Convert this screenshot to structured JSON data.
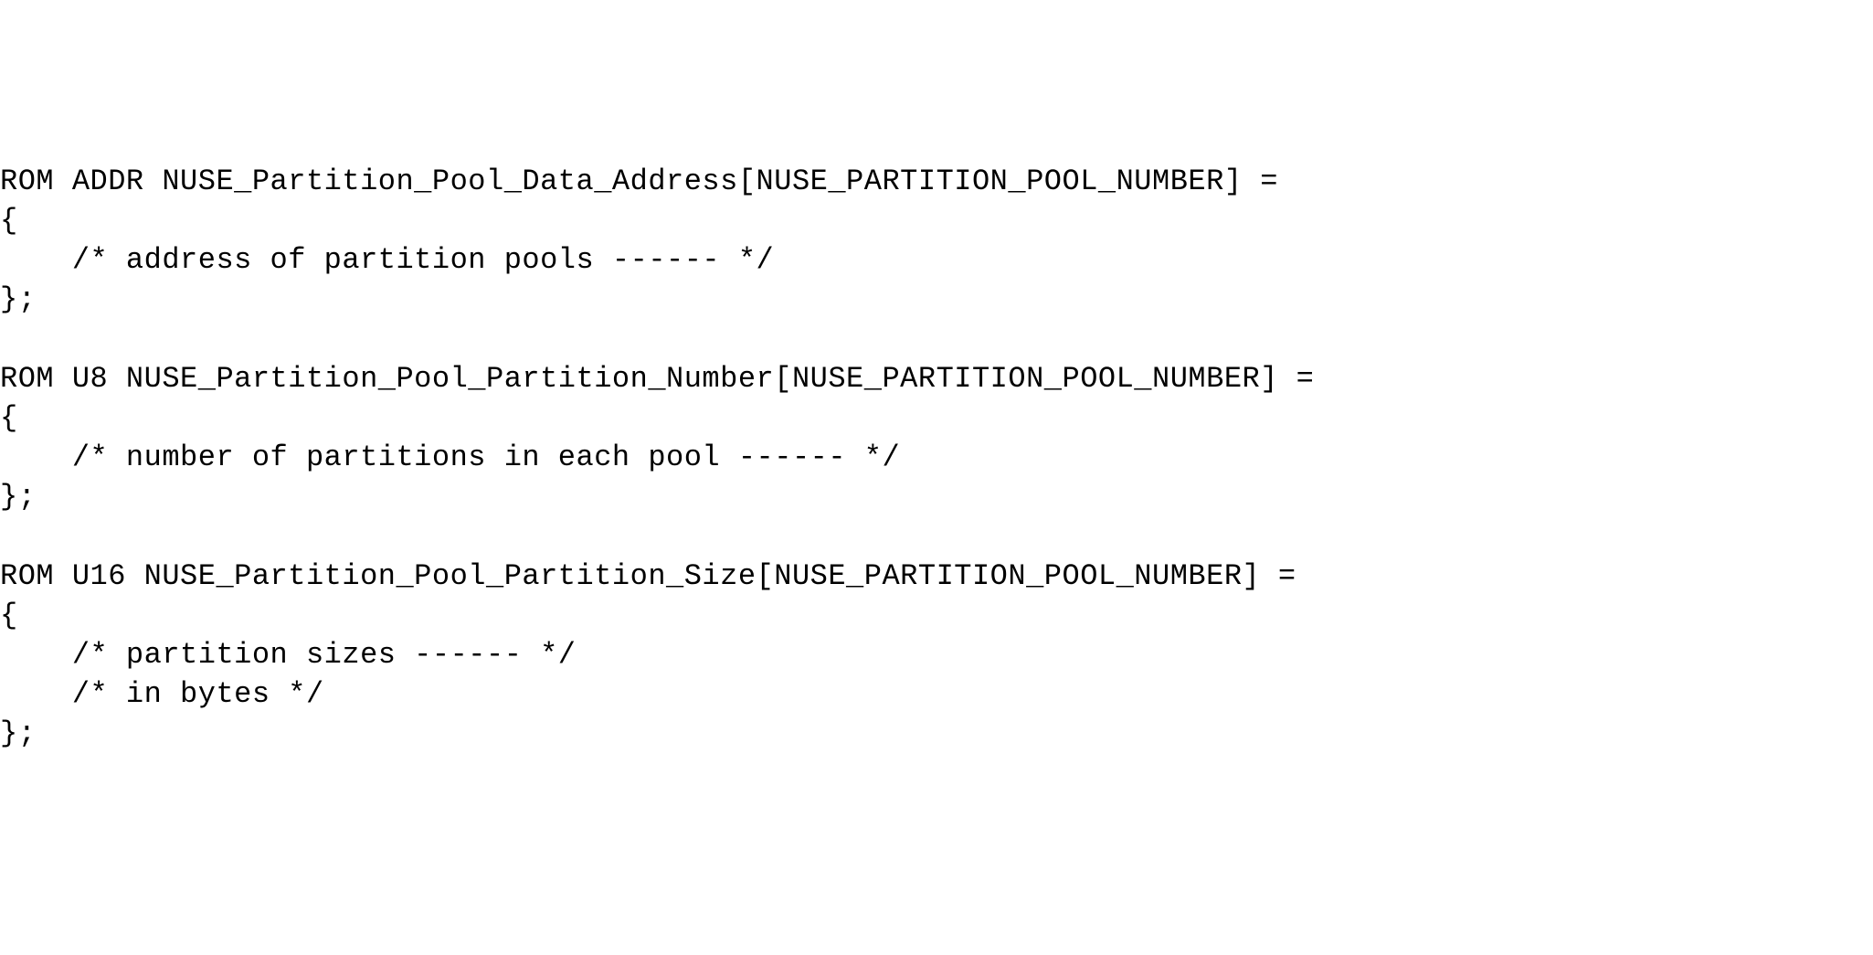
{
  "code": {
    "line1": "ROM ADDR NUSE_Partition_Pool_Data_Address[NUSE_PARTITION_POOL_NUMBER] =",
    "line2": "{",
    "line3": "    /* address of partition pools ------ */",
    "line4": "};",
    "line5": "",
    "line6": "ROM U8 NUSE_Partition_Pool_Partition_Number[NUSE_PARTITION_POOL_NUMBER] =",
    "line7": "{",
    "line8": "    /* number of partitions in each pool ------ */",
    "line9": "};",
    "line10": "",
    "line11": "ROM U16 NUSE_Partition_Pool_Partition_Size[NUSE_PARTITION_POOL_NUMBER] =",
    "line12": "{",
    "line13": "    /* partition sizes ------ */",
    "line14": "    /* in bytes */",
    "line15": "};"
  }
}
